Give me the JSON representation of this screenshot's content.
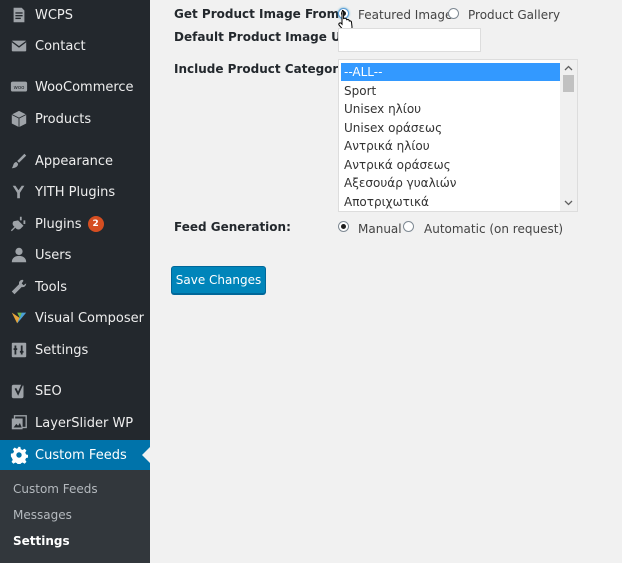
{
  "sidebar": {
    "items": [
      {
        "label": "WCPS",
        "icon": "document-icon"
      },
      {
        "label": "Contact",
        "icon": "mail-icon"
      },
      {
        "label": "WooCommerce",
        "icon": "woocommerce-icon"
      },
      {
        "label": "Products",
        "icon": "cube-icon"
      },
      {
        "label": "Appearance",
        "icon": "paintbrush-icon"
      },
      {
        "label": "YITH Plugins",
        "icon": "yith-icon"
      },
      {
        "label": "Plugins",
        "icon": "plug-icon",
        "badge": "2"
      },
      {
        "label": "Users",
        "icon": "user-icon"
      },
      {
        "label": "Tools",
        "icon": "wrench-icon"
      },
      {
        "label": "Visual Composer",
        "icon": "visual-composer-icon"
      },
      {
        "label": "Settings",
        "icon": "settings-icon"
      },
      {
        "label": "SEO",
        "icon": "yoast-icon"
      },
      {
        "label": "LayerSlider WP",
        "icon": "layers-icon"
      },
      {
        "label": "Custom Feeds",
        "icon": "gear-icon",
        "current": true
      }
    ],
    "submenu": [
      "Custom Feeds",
      "Messages",
      "Settings"
    ],
    "submenu_active": "Settings",
    "accent_color": "#0073aa",
    "badge_color": "#d54e21"
  },
  "form": {
    "image_source": {
      "label": "Get Product Image From:",
      "options": [
        "Featured Image",
        "Product Gallery"
      ],
      "selected": "Featured Image"
    },
    "default_image_url": {
      "label": "Default Product Image URL:",
      "value": ""
    },
    "categories": {
      "label": "Include Product Categories:",
      "options": [
        "--ALL--",
        "Sport",
        "Unisex ηλίου",
        "Unisex οράσεως",
        "Αντρικά ηλίου",
        "Αντρικά οράσεως",
        "Αξεσουάρ γυαλιών",
        "Αποτριχωτικά"
      ],
      "selected": "--ALL--"
    },
    "feed_generation": {
      "label": "Feed Generation:",
      "options": [
        "Manual",
        "Automatic (on request)"
      ],
      "selected": "Manual"
    },
    "save_label": "Save Changes",
    "button_color": "#0085ba"
  }
}
